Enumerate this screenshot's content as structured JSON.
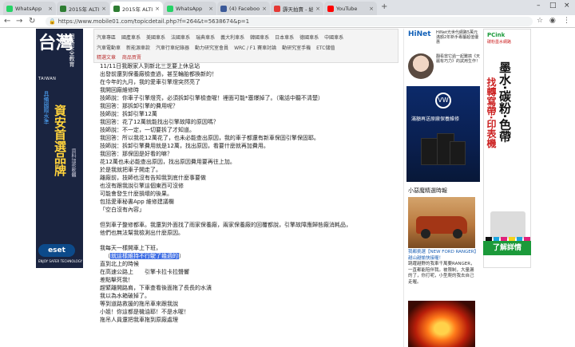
{
  "browser": {
    "tabs": [
      {
        "title": "WhatsApp",
        "color": "#25d366"
      },
      {
        "title": "2015年 ALTIS 渦輪...",
        "color": "#2e7d32"
      },
      {
        "title": "2015年 ALTIS 渦輪...",
        "color": "#2e7d32",
        "active": true
      },
      {
        "title": "WhatsApp",
        "color": "#25d366"
      },
      {
        "title": "(4) Facebook",
        "color": "#3b5998"
      },
      {
        "title": "霹天拍賣 - 給尋找好...",
        "color": "#e53935"
      },
      {
        "title": "YouTube",
        "color": "#ff0000"
      }
    ],
    "url": "https://www.mobile01.com/topicdetail.php?f=264&t=5638674&p=1"
  },
  "left_ad": {
    "big_text": "台灣",
    "latin": "TAIWAN",
    "vertical_top": "網路安全教育",
    "vertical_accent": "具備國際水準",
    "headline": "資安首選品牌",
    "vertical_small": "資料加密軟體",
    "logo": "eset",
    "tagline": "ENJOY SAFER TECHNOLOGY"
  },
  "site_nav": {
    "row1": [
      "汽車專區",
      "國產車系",
      "美國車系",
      "法國車系",
      "瑞典車系",
      "義大利車系",
      "韓國車系",
      "日本車系",
      "德國車系",
      "中國車系"
    ],
    "row2": [
      "汽車電動車",
      "新能源車款",
      "汽車行車紀錄器",
      "動力研究室會員",
      "WRC / F1 賽車討論",
      "動研究室手機",
      "ETC儲值"
    ],
    "highlight": "精選文章 　商品買賣"
  },
  "post": {
    "lines": [
      "11/11日我跟家人到新北三芝要上休息站",
      "出發前還到保養廠檢查過，甚至輪胎都換新的！",
      "在今年的九月，我的愛車引擎燈突然亮了",
      "我開回廠維修時",
      "技師說：你車子引擎燈亮，必須拆卸引擎檢查喔！裡面可能*塞爆掉了。（電話中聽不清楚）",
      "我回答：那拆卸引擎的費用呢？",
      "技師說：拆卸引擎12萬",
      "我回答：花了12萬就能找出引擎故障的原因嗎？",
      "技師說：不一定，一切要拆了才知道。",
      "我回答：所以我花12萬花了，也未必能查出原因，我的車子都還有新車保固引擎保固耶。",
      "技師說：拆卸引擎費用就是12萬，找出原因，看要什麼就再加費用。",
      "我回答：那保固是好看的嘛？",
      "花12萬也未必能查出原因，找出原因費用要再往上加。",
      "於是我就把車子開走了。",
      "離廠前，技師也沒有告知我到底什麼事要做",
      "也沒有跟我說引擎這個東西可沒修",
      "可能會發生什麼損壞的後果。",
      "包括愛車秘書App 維修建議欄",
      "「空白沒有內容」"
    ],
    "paragraph2": [
      "但到車子整修都車。我還到外面找了雨家保養廠，兩家保養廠的回覆都說，引擎故障應歸咎廠消耗品，",
      "他們也無法幫我檢測出什麼原因。"
    ],
    "paragraph3": [
      "我每天一樣開車上下班，",
      "（就這樣維持不行駛了幾週的）",
      "直到北上的時候",
      "在高速公路上　　引擎卡拉卡拉聲響",
      "差點擊死我！",
      "趕緊離開路肩，下車查看後面拖了長長的水漬",
      "我以為水箱破掉了。",
      "等到道路救援的拖吊車來跟我說",
      "小姐！你這都是機油耶！不是水喔！",
      "拖吊人員還把我車拖到原廠處理"
    ],
    "selected_line": "就這樣維持不行駛了幾週的"
  },
  "right_col": {
    "hinet": {
      "logo": "HiNet",
      "text": "HiNet光世代網路5萬元滿額2年新手專屬超值優惠"
    },
    "mom": {
      "text": "翻看當它過一起難搞《天麗有巧力》的試用生作！"
    },
    "vw_ad": {
      "brand": "VW",
      "caption": "滿額再送原廠保養維修"
    },
    "section_title": "小惡魔精選時報",
    "ford": {
      "title": "我都挑選【NEW FORD RANGER】越山越愉快接喔！",
      "body": "跳躍越野的我車千萬要RANGER，一直都能陪伴我。被限制，大量漏的了，你打呢，小型爬的我去自己走喔。"
    }
  },
  "pcink_ad": {
    "brand": "PCink",
    "sub": "碳粉墨水網路",
    "vertical_black": "墨水·碳粉·色帶",
    "vertical_red": "找轉寫帶·印表機",
    "cta": "了解詳情",
    "ink_colors": [
      "#111111",
      "#1aa6e0",
      "#e0217a",
      "#f4d21a",
      "#1aa6e0",
      "#e0217a"
    ]
  }
}
